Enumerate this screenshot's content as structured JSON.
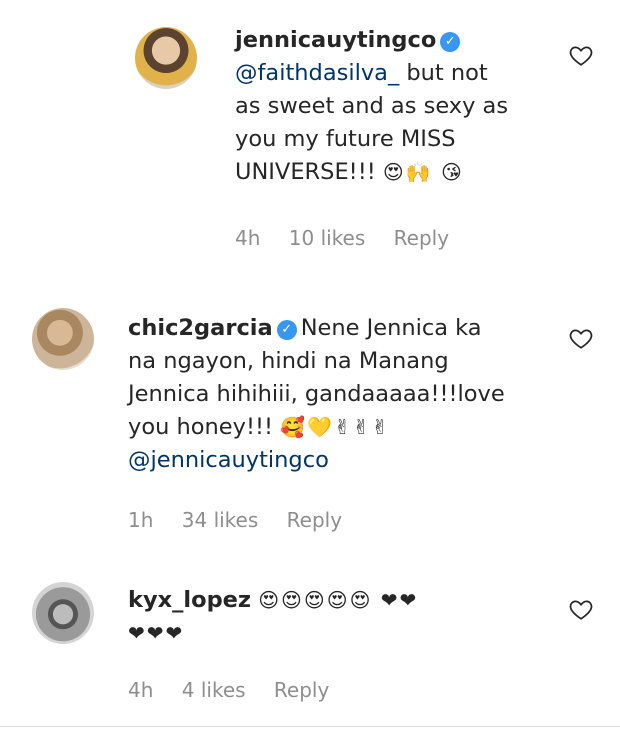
{
  "comments": [
    {
      "username": "jennicauytingco",
      "verified": true,
      "mention": "@faithdasilva_",
      "text_lines": [
        "but not",
        "as sweet and as sexy as",
        "you my future MISS",
        "UNIVERSE!!!"
      ],
      "emojis": "😍🙌 😘",
      "time": "4h",
      "likes": "10 likes",
      "reply": "Reply"
    },
    {
      "username": "chic2garcia",
      "verified": true,
      "text_lines": [
        "Nene Jennica ka",
        "na ngayon, hindi na Manang",
        "Jennica hihihiii, gandaaaaa!!!love",
        "you honey!!!"
      ],
      "emojis": "🥰💛✌✌✌",
      "mention": "@jennicauytingco",
      "time": "1h",
      "likes": "34 likes",
      "reply": "Reply"
    },
    {
      "username": "kyx_lopez",
      "verified": false,
      "emojis_line1": "😍😍😍😍😍 ❤❤",
      "emojis_line2": "❤❤❤",
      "time": "4h",
      "likes": "4 likes",
      "reply": "Reply"
    }
  ],
  "icons": {
    "like": "heart-outline-icon",
    "verified": "verified-badge-icon"
  },
  "colors": {
    "text": "#262626",
    "meta": "#8e8e8e",
    "mention": "#003569",
    "verified": "#3897f0"
  }
}
